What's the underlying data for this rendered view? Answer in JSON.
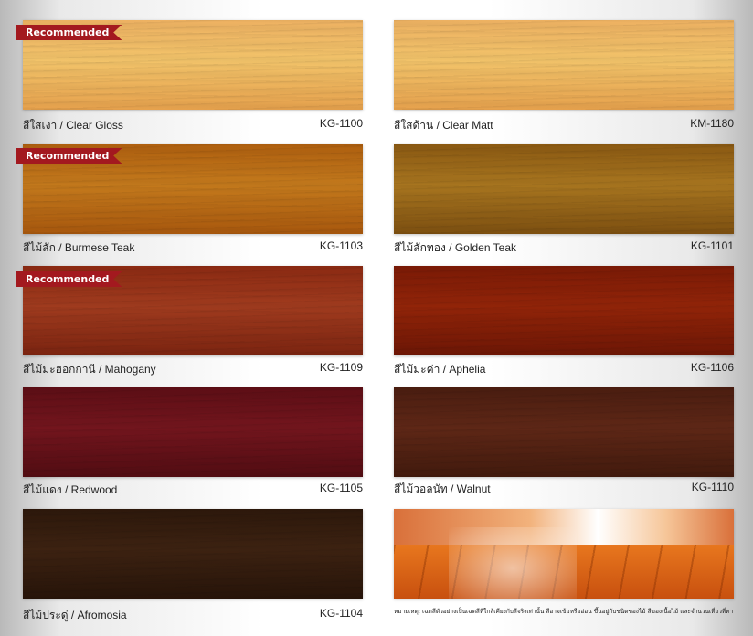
{
  "recommended_label": "Recommended",
  "swatches": [
    {
      "name": "สีใสเงา / Clear Gloss",
      "code": "KG-1100",
      "recommended": true,
      "color_top": "#eeb262",
      "color_mid": "#f3c46a",
      "color_bot": "#e7a24d"
    },
    {
      "name": "สีใสด้าน / Clear Matt",
      "code": "KM-1180",
      "recommended": false,
      "color_top": "#eeb262",
      "color_mid": "#f3c46a",
      "color_bot": "#e7a24d"
    },
    {
      "name": "สีไม้สัก / Burmese Teak",
      "code": "KG-1103",
      "recommended": true,
      "color_top": "#b0600f",
      "color_mid": "#c57a1c",
      "color_bot": "#a9580d"
    },
    {
      "name": "สีไม้สักทอง / Golden Teak",
      "code": "KG-1101",
      "recommended": false,
      "color_top": "#8c5a12",
      "color_mid": "#a9761f",
      "color_bot": "#7e5010"
    },
    {
      "name": "สีไม้มะฮอกกานี / Mahogany",
      "code": "KG-1109",
      "recommended": true,
      "color_top": "#8d2a12",
      "color_mid": "#a13b1e",
      "color_bot": "#7d2410"
    },
    {
      "name": "สีไม้มะค่า / Aphelia",
      "code": "KG-1106",
      "recommended": false,
      "color_top": "#7c1a06",
      "color_mid": "#932408",
      "color_bot": "#6e1605"
    },
    {
      "name": "สีไม้แดง / Redwood",
      "code": "KG-1105",
      "recommended": false,
      "color_top": "#5e0e15",
      "color_mid": "#74151d",
      "color_bot": "#520c12"
    },
    {
      "name": "สีไม้วอลนัท / Walnut",
      "code": "KG-1110",
      "recommended": false,
      "color_top": "#4b1d10",
      "color_mid": "#5f2716",
      "color_bot": "#421a0d"
    },
    {
      "name": "สีไม้ประดู่ / Afromosia",
      "code": "KG-1104",
      "recommended": false,
      "color_top": "#2d180b",
      "color_mid": "#3d2211",
      "color_bot": "#271409"
    }
  ],
  "note": "หมายเหตุ: เฉดสีตัวอย่างเป็นเฉดสีที่ใกล้เคียงกับสีจริงเท่านั้น สีอาจเข้มหรืออ่อน ขึ้นอยู่กับชนิดของไม้ สีของเนื้อไม้ และจำนวนเที่ยวที่ทา"
}
